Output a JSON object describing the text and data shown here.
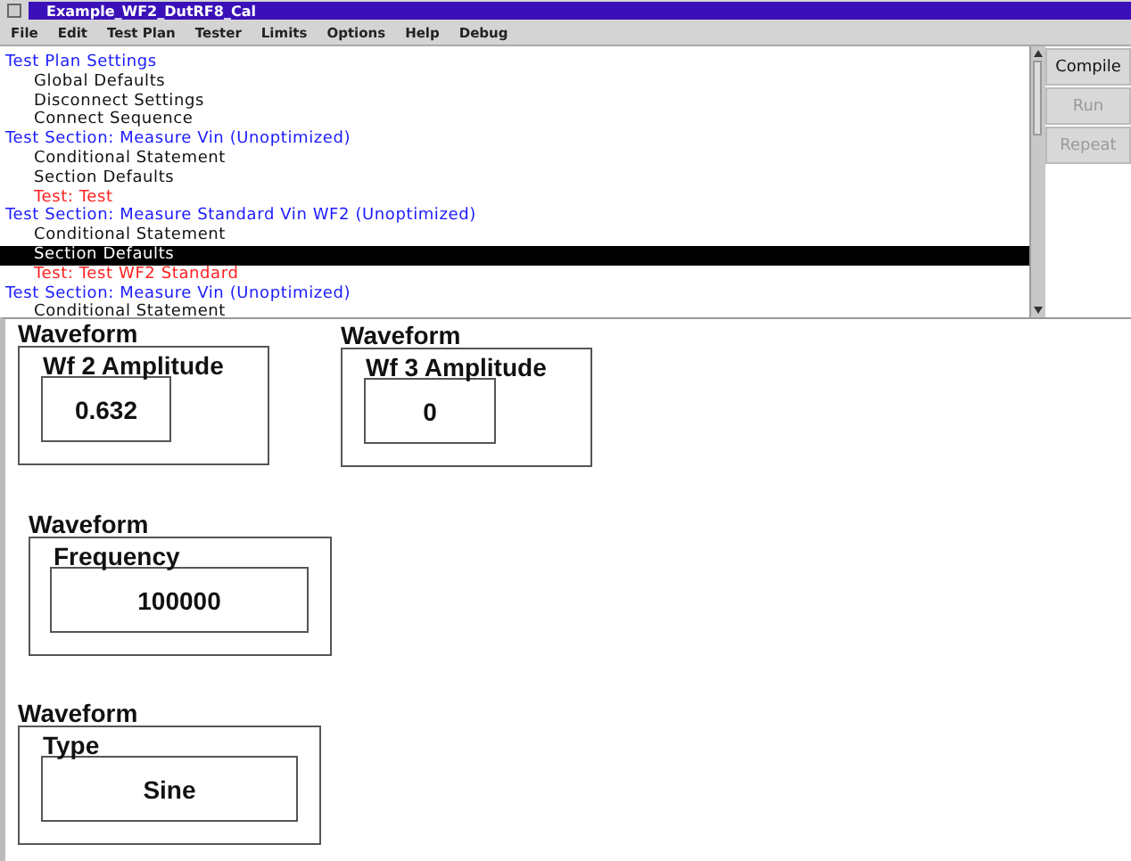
{
  "window": {
    "title": "Example_WF2_DutRF8_Cal"
  },
  "menu": [
    "File",
    "Edit",
    "Test Plan",
    "Tester",
    "Limits",
    "Options",
    "Help",
    "Debug"
  ],
  "tree": [
    {
      "kind": "section",
      "label": "Test Plan Settings",
      "selected": false,
      "children": [
        {
          "kind": "item",
          "label": "Global Defaults",
          "selected": false
        },
        {
          "kind": "item",
          "label": "Disconnect Settings",
          "selected": false
        },
        {
          "kind": "item",
          "label": "Connect Sequence",
          "selected": false
        }
      ]
    },
    {
      "kind": "section",
      "label": "Test Section: Measure Vin (Unoptimized)",
      "selected": false,
      "children": [
        {
          "kind": "item",
          "label": "Conditional Statement",
          "selected": false
        },
        {
          "kind": "item",
          "label": "Section Defaults",
          "selected": false
        },
        {
          "kind": "test",
          "label": "Test: Test",
          "selected": false
        }
      ]
    },
    {
      "kind": "section",
      "label": "Test Section: Measure Standard Vin WF2 (Unoptimized)",
      "selected": false,
      "children": [
        {
          "kind": "item",
          "label": "Conditional Statement",
          "selected": false
        },
        {
          "kind": "item",
          "label": "Section Defaults",
          "selected": true
        },
        {
          "kind": "test",
          "label": "Test: Test WF2 Standard",
          "selected": false
        }
      ]
    },
    {
      "kind": "section",
      "label": "Test Section: Measure Vin (Unoptimized)",
      "selected": false,
      "children": [
        {
          "kind": "item",
          "label": "Conditional Statement",
          "selected": false
        }
      ]
    }
  ],
  "buttons": [
    {
      "label": "Compile",
      "disabled": false
    },
    {
      "label": "Run",
      "disabled": true
    },
    {
      "label": "Repeat",
      "disabled": true
    }
  ],
  "widgets": [
    {
      "group": "Waveform",
      "title": "Wf 2 Amplitude",
      "value": "0.632"
    },
    {
      "group": "Waveform",
      "title": "Wf 3 Amplitude",
      "value": "0"
    },
    {
      "group": "Waveform",
      "title": "Frequency",
      "value": "100000"
    },
    {
      "group": "Waveform",
      "title": "Type",
      "value": "Sine"
    }
  ]
}
